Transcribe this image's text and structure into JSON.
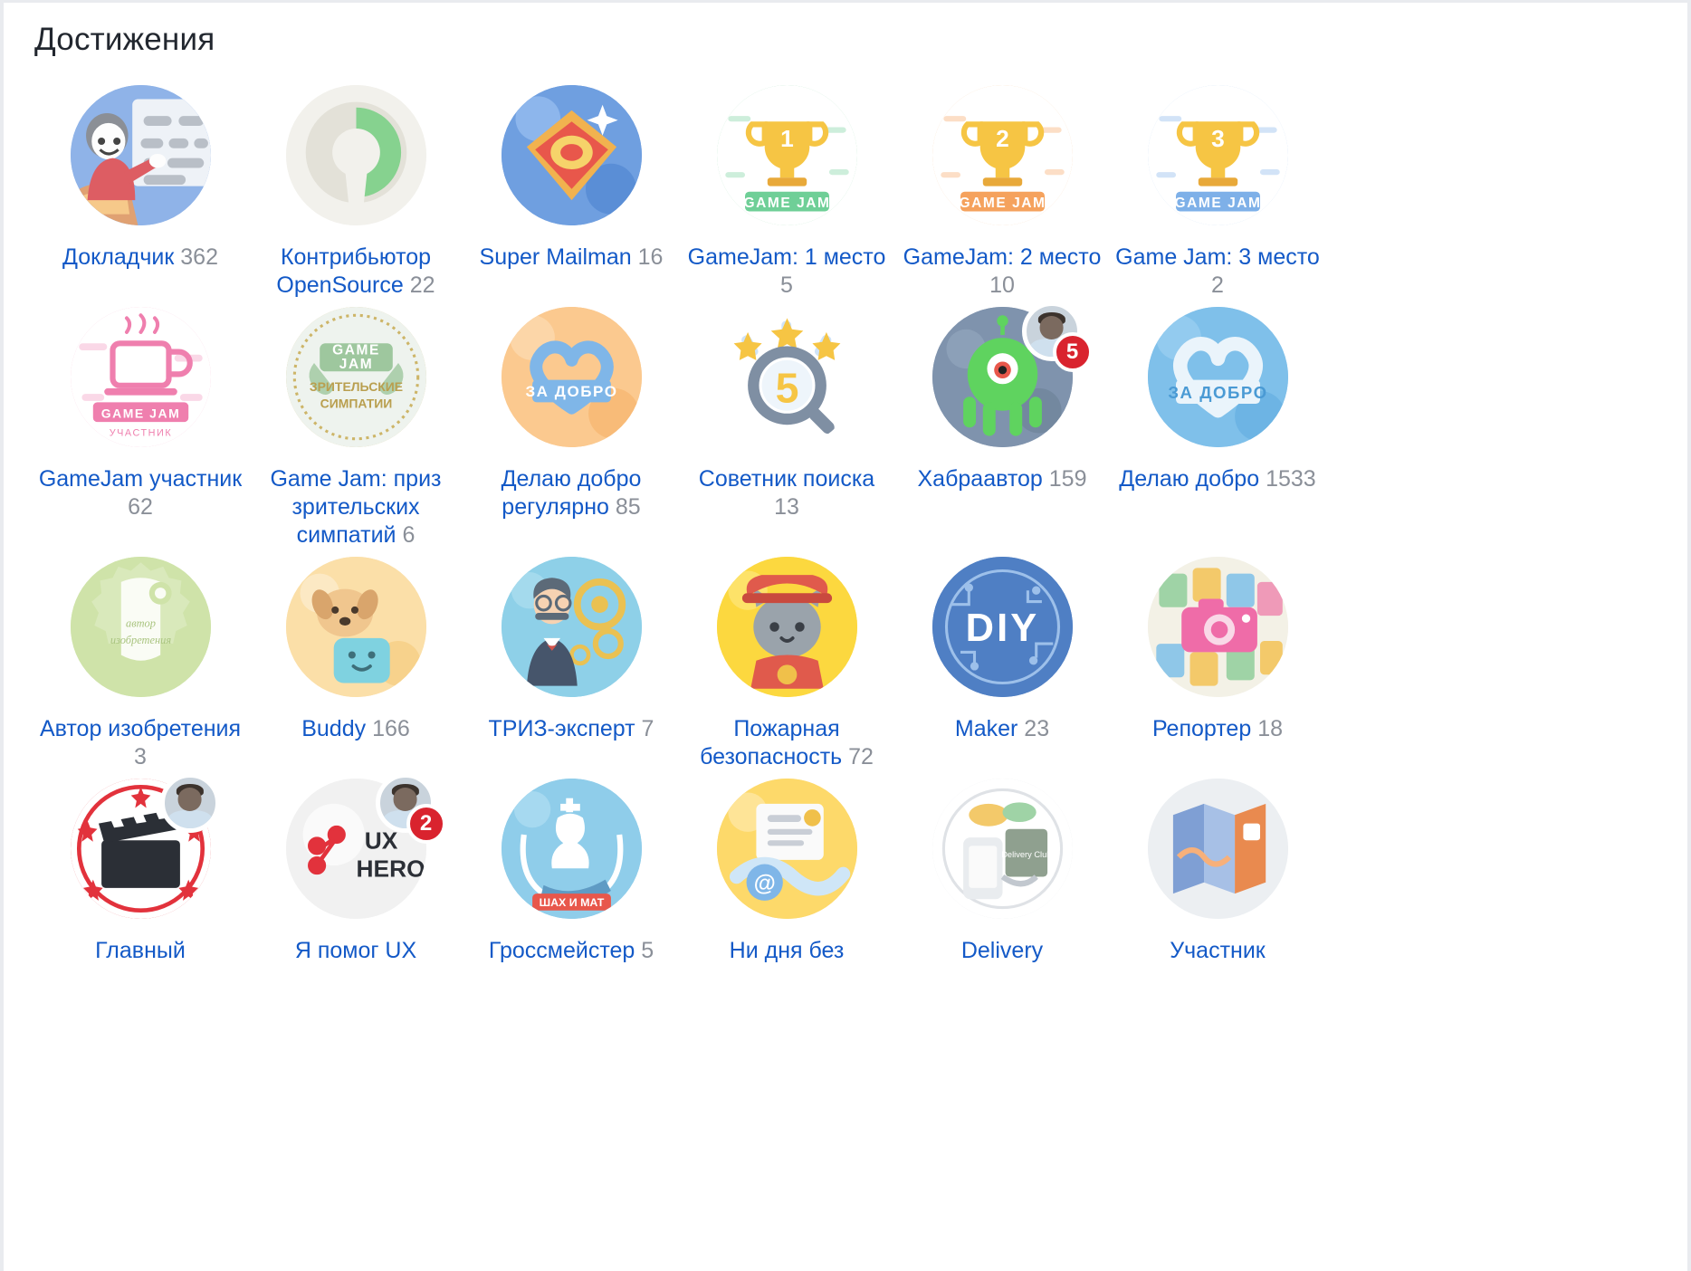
{
  "page": {
    "title": "Достижения"
  },
  "colors": {
    "link": "#1359c7",
    "count": "#8a8f98",
    "title": "#22272f",
    "notification": "#d9232e",
    "background": "#ffffff"
  },
  "achievements": [
    {
      "label": "Докладчик",
      "count": "362",
      "icon": "speaker-presenting-icon",
      "bg": "#8fb3e8",
      "accent": "#dd5d63"
    },
    {
      "label": "Контрибьютор OpenSource",
      "count": "22",
      "icon": "opensource-logo-icon",
      "bg": "#f2f1ec",
      "accent": "#7ed396"
    },
    {
      "label": "Super Mailman",
      "count": "16",
      "icon": "super-mail-icon",
      "bg": "#6f9fe0",
      "accent": "#f0a84a"
    },
    {
      "label": "GameJam: 1 место",
      "count": "5",
      "icon": "trophy-gold-icon",
      "bg": "#ffffff",
      "accent": "#6fcf97",
      "ring": "#8bd5a6"
    },
    {
      "label": "GameJam: 2 место",
      "count": "10",
      "icon": "trophy-silver-icon",
      "bg": "#ffffff",
      "accent": "#f5a25d",
      "ring": "#f7bd8c"
    },
    {
      "label": "Game Jam: 3 место",
      "count": "2",
      "icon": "trophy-bronze-icon",
      "bg": "#ffffff",
      "accent": "#7eb0e8",
      "ring": "#a8c9ee"
    },
    {
      "label": "GameJam участник",
      "count": "62",
      "icon": "coffee-cup-icon",
      "bg": "#ffffff",
      "accent": "#ef7fae",
      "ring": "#f3a6c5"
    },
    {
      "label": "Game Jam: приз зрительских симпатий",
      "count": "6",
      "icon": "gamejam-wreath-icon",
      "bg": "#eef3ee",
      "accent": "#cdb568",
      "ring": "#d8c88a"
    },
    {
      "label": "Делаю добро регулярно",
      "count": "85",
      "icon": "heart-orange-icon",
      "bg": "#fbc98f",
      "accent": "#7fb6e8"
    },
    {
      "label": "Советник поиска",
      "count": "13",
      "icon": "magnifier-five-icon",
      "bg": "#ffffff",
      "accent": "#f6c544"
    },
    {
      "label": "Хабраавтор",
      "count": "159",
      "icon": "green-alien-icon",
      "bg": "#7f93ad",
      "accent": "#5fd35f",
      "avatar": true,
      "notify": "5"
    },
    {
      "label": "Делаю добро",
      "count": "1533",
      "icon": "heart-blue-icon",
      "bg": "#7fc0ea",
      "accent": "#eaf4fb"
    },
    {
      "label": "Автор изобретения",
      "count": "3",
      "icon": "scroll-certificate-icon",
      "bg": "#cfe3a9",
      "accent": "#ffffff"
    },
    {
      "label": "Buddy",
      "count": "166",
      "icon": "dog-pillow-icon",
      "bg": "#fbdfa8",
      "accent": "#7fd2e0"
    },
    {
      "label": "ТРИЗ-эксперт",
      "count": "7",
      "icon": "inventor-gears-icon",
      "bg": "#8ed0e8",
      "accent": "#f0c04a"
    },
    {
      "label": "Пожарная безопасность",
      "count": "72",
      "icon": "firefighter-cat-icon",
      "bg": "#fcd83f",
      "accent": "#e05a4c"
    },
    {
      "label": "Maker",
      "count": "23",
      "icon": "diy-circuit-icon",
      "bg": "#4f7fc4",
      "accent": "#ffffff"
    },
    {
      "label": "Репортер",
      "count": "18",
      "icon": "camera-photos-icon",
      "bg": "#f3f1e6",
      "accent": "#ef6ca8"
    },
    {
      "label": "Главный",
      "count": "",
      "icon": "clapperboard-icon",
      "bg": "#ffffff",
      "accent": "#e2323c",
      "ring": "#e2323c",
      "avatar": true
    },
    {
      "label": "Я помог UX",
      "count": "",
      "icon": "ux-hero-icon",
      "bg": "#f1f1f1",
      "accent": "#e2323c",
      "avatar": true,
      "notify": "2"
    },
    {
      "label": "Гроссмейстер",
      "count": "5",
      "icon": "chess-king-icon",
      "bg": "#8fcdea",
      "accent": "#ffffff"
    },
    {
      "label": "Ни дня без",
      "count": "",
      "icon": "letter-envelope-icon",
      "bg": "#fdd96a",
      "accent": "#7fb6e8"
    },
    {
      "label": "Delivery",
      "count": "",
      "icon": "delivery-club-icon",
      "bg": "#ffffff",
      "accent": "#9aa3ad",
      "ring": "#dfe2e6"
    },
    {
      "label": "Участник",
      "count": "",
      "icon": "folded-map-icon",
      "bg": "#eceff2",
      "accent": "#7f9fd4"
    }
  ]
}
